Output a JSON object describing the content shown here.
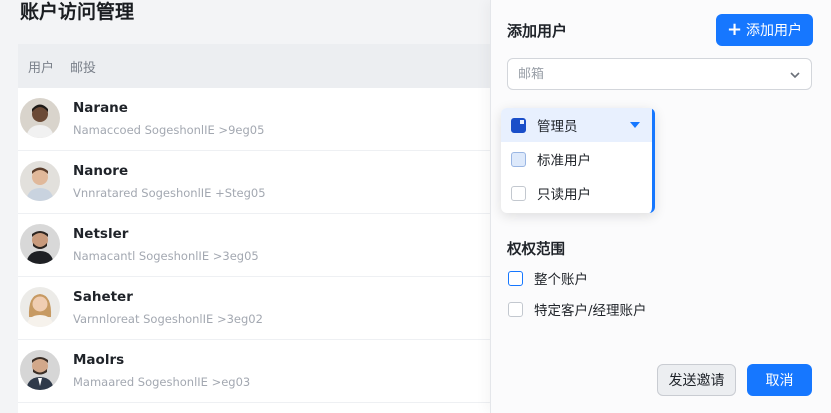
{
  "page": {
    "title": "账户访问管理"
  },
  "list": {
    "headers": [
      "用户",
      "邮投"
    ],
    "users": [
      {
        "name": "Narane",
        "detail": "Namaccoed SogeshonlIE >9eg05",
        "avatar": "avatar-man-1"
      },
      {
        "name": "Nanore",
        "detail": "Vnnratared SogeshonlIE +Steg05",
        "avatar": "avatar-man-2"
      },
      {
        "name": "Netsler",
        "detail": "Namacantl SogeshonlIE >3eg05",
        "avatar": "avatar-man-3"
      },
      {
        "name": "Saheter",
        "detail": "Varnnloreat SogeshonlIE >3eg02",
        "avatar": "avatar-woman-1"
      },
      {
        "name": "Maolrs",
        "detail": "Mamaared SogeshonlIE >eg03",
        "avatar": "avatar-man-4"
      }
    ]
  },
  "panel": {
    "title": "添加用户",
    "add_button": "添加用户",
    "email_placeholder": "邮箱",
    "roles": [
      {
        "label": "管理员",
        "state": "selected"
      },
      {
        "label": "标准用户",
        "state": "unchecked"
      },
      {
        "label": "只读用户",
        "state": "unchecked"
      }
    ],
    "scope_title": "权权范围",
    "scope_options": [
      {
        "label": "整个账户"
      },
      {
        "label": "特定客户/经理账户"
      }
    ],
    "send_button": "发送邀请",
    "cancel_button": "取消"
  },
  "colors": {
    "accent": "#1677ff",
    "selected_box": "#1a4ec9"
  }
}
